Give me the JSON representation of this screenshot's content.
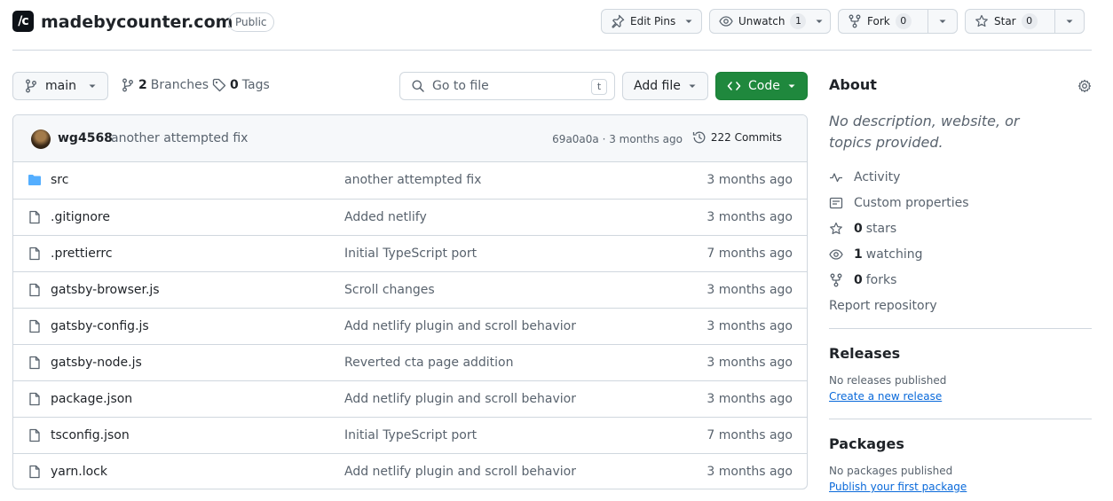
{
  "repo": {
    "logo_text": "/c",
    "name": "madebycounter.com",
    "visibility": "Public"
  },
  "header_buttons": {
    "edit_pins": "Edit Pins",
    "unwatch": "Unwatch",
    "unwatch_count": "1",
    "fork": "Fork",
    "fork_count": "0",
    "star": "Star",
    "star_count": "0"
  },
  "toolbar": {
    "branch": "main",
    "branches_count": "2",
    "branches_label": "Branches",
    "tags_count": "0",
    "tags_label": "Tags",
    "search_placeholder": "Go to file",
    "search_shortcut": "t",
    "add_file": "Add file",
    "code": "Code"
  },
  "latest_commit": {
    "author": "wg4568",
    "message": "another attempted fix",
    "hash_time": "69a0a0a · 3 months ago",
    "commits": "222 Commits"
  },
  "files": [
    {
      "name": "src",
      "type": "folder",
      "message": "another attempted fix",
      "date": "3 months ago"
    },
    {
      "name": ".gitignore",
      "type": "file",
      "message": "Added netlify",
      "date": "3 months ago"
    },
    {
      "name": ".prettierrc",
      "type": "file",
      "message": "Initial TypeScript port",
      "date": "7 months ago"
    },
    {
      "name": "gatsby-browser.js",
      "type": "file",
      "message": "Scroll changes",
      "date": "3 months ago"
    },
    {
      "name": "gatsby-config.js",
      "type": "file",
      "message": "Add netlify plugin and scroll behavior",
      "date": "3 months ago"
    },
    {
      "name": "gatsby-node.js",
      "type": "file",
      "message": "Reverted cta page addition",
      "date": "3 months ago"
    },
    {
      "name": "package.json",
      "type": "file",
      "message": "Add netlify plugin and scroll behavior",
      "date": "3 months ago"
    },
    {
      "name": "tsconfig.json",
      "type": "file",
      "message": "Initial TypeScript port",
      "date": "7 months ago"
    },
    {
      "name": "yarn.lock",
      "type": "file",
      "message": "Add netlify plugin and scroll behavior",
      "date": "3 months ago"
    }
  ],
  "about": {
    "title": "About",
    "description": "No description, website, or topics provided.",
    "activity": "Activity",
    "custom_properties": "Custom properties",
    "stars_count": "0",
    "stars_label": "stars",
    "watching_count": "1",
    "watching_label": "watching",
    "forks_count": "0",
    "forks_label": "forks",
    "report": "Report repository"
  },
  "releases": {
    "title": "Releases",
    "empty": "No releases published",
    "link": "Create a new release"
  },
  "packages": {
    "title": "Packages",
    "empty": "No packages published",
    "link": "Publish your first package"
  },
  "colors": {
    "accent_green": "#1f883d",
    "link_blue": "#0969da",
    "folder_blue": "#54aeff",
    "border": "#d0d7de",
    "muted_text": "#59636e"
  }
}
